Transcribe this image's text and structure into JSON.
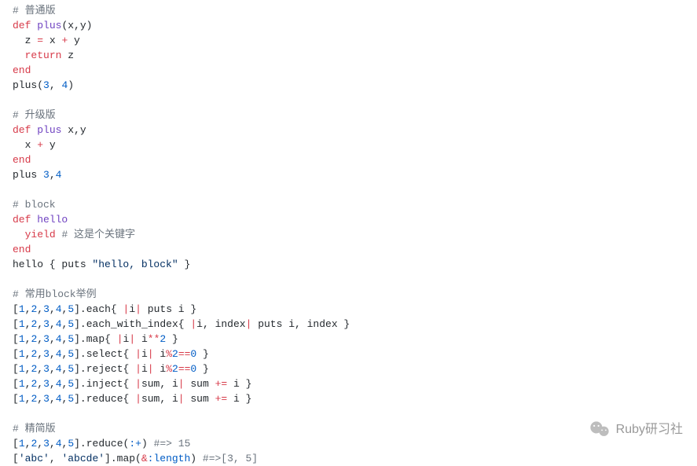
{
  "code": {
    "lines": [
      [
        [
          "comment",
          "# 普通版"
        ]
      ],
      [
        [
          "keyword",
          "def"
        ],
        [
          "plain",
          " "
        ],
        [
          "func",
          "plus"
        ],
        [
          "plain",
          "(x,y)"
        ]
      ],
      [
        [
          "plain",
          "  z "
        ],
        [
          "op",
          "="
        ],
        [
          "plain",
          " x "
        ],
        [
          "op",
          "+"
        ],
        [
          "plain",
          " y"
        ]
      ],
      [
        [
          "plain",
          "  "
        ],
        [
          "keyword",
          "return"
        ],
        [
          "plain",
          " z"
        ]
      ],
      [
        [
          "keyword",
          "end"
        ]
      ],
      [
        [
          "plain",
          "plus("
        ],
        [
          "num",
          "3"
        ],
        [
          "plain",
          ", "
        ],
        [
          "num",
          "4"
        ],
        [
          "plain",
          ")"
        ]
      ],
      [
        [
          "plain",
          ""
        ]
      ],
      [
        [
          "comment",
          "# 升级版"
        ]
      ],
      [
        [
          "keyword",
          "def"
        ],
        [
          "plain",
          " "
        ],
        [
          "func",
          "plus"
        ],
        [
          "plain",
          " x,y"
        ]
      ],
      [
        [
          "plain",
          "  x "
        ],
        [
          "op",
          "+"
        ],
        [
          "plain",
          " y"
        ]
      ],
      [
        [
          "keyword",
          "end"
        ]
      ],
      [
        [
          "plain",
          "plus "
        ],
        [
          "num",
          "3"
        ],
        [
          "plain",
          ","
        ],
        [
          "num",
          "4"
        ]
      ],
      [
        [
          "plain",
          ""
        ]
      ],
      [
        [
          "comment",
          "# block"
        ]
      ],
      [
        [
          "keyword",
          "def"
        ],
        [
          "plain",
          " "
        ],
        [
          "func",
          "hello"
        ]
      ],
      [
        [
          "plain",
          "  "
        ],
        [
          "keyword",
          "yield"
        ],
        [
          "plain",
          " "
        ],
        [
          "comment",
          "# 这是个关键字"
        ]
      ],
      [
        [
          "keyword",
          "end"
        ]
      ],
      [
        [
          "plain",
          "hello { puts "
        ],
        [
          "string",
          "\"hello, block\""
        ],
        [
          "plain",
          " }"
        ]
      ],
      [
        [
          "plain",
          ""
        ]
      ],
      [
        [
          "comment",
          "# 常用block举例"
        ]
      ],
      [
        [
          "plain",
          "["
        ],
        [
          "num",
          "1"
        ],
        [
          "plain",
          ","
        ],
        [
          "num",
          "2"
        ],
        [
          "plain",
          ","
        ],
        [
          "num",
          "3"
        ],
        [
          "plain",
          ","
        ],
        [
          "num",
          "4"
        ],
        [
          "plain",
          ","
        ],
        [
          "num",
          "5"
        ],
        [
          "plain",
          "].each{ "
        ],
        [
          "op",
          "|"
        ],
        [
          "plain",
          "i"
        ],
        [
          "op",
          "|"
        ],
        [
          "plain",
          " puts i }"
        ]
      ],
      [
        [
          "plain",
          "["
        ],
        [
          "num",
          "1"
        ],
        [
          "plain",
          ","
        ],
        [
          "num",
          "2"
        ],
        [
          "plain",
          ","
        ],
        [
          "num",
          "3"
        ],
        [
          "plain",
          ","
        ],
        [
          "num",
          "4"
        ],
        [
          "plain",
          ","
        ],
        [
          "num",
          "5"
        ],
        [
          "plain",
          "].each_with_index{ "
        ],
        [
          "op",
          "|"
        ],
        [
          "plain",
          "i, index"
        ],
        [
          "op",
          "|"
        ],
        [
          "plain",
          " puts i, index }"
        ]
      ],
      [
        [
          "plain",
          "["
        ],
        [
          "num",
          "1"
        ],
        [
          "plain",
          ","
        ],
        [
          "num",
          "2"
        ],
        [
          "plain",
          ","
        ],
        [
          "num",
          "3"
        ],
        [
          "plain",
          ","
        ],
        [
          "num",
          "4"
        ],
        [
          "plain",
          ","
        ],
        [
          "num",
          "5"
        ],
        [
          "plain",
          "].map{ "
        ],
        [
          "op",
          "|"
        ],
        [
          "plain",
          "i"
        ],
        [
          "op",
          "|"
        ],
        [
          "plain",
          " i"
        ],
        [
          "op",
          "**"
        ],
        [
          "num",
          "2"
        ],
        [
          "plain",
          " }"
        ]
      ],
      [
        [
          "plain",
          "["
        ],
        [
          "num",
          "1"
        ],
        [
          "plain",
          ","
        ],
        [
          "num",
          "2"
        ],
        [
          "plain",
          ","
        ],
        [
          "num",
          "3"
        ],
        [
          "plain",
          ","
        ],
        [
          "num",
          "4"
        ],
        [
          "plain",
          ","
        ],
        [
          "num",
          "5"
        ],
        [
          "plain",
          "].select{ "
        ],
        [
          "op",
          "|"
        ],
        [
          "plain",
          "i"
        ],
        [
          "op",
          "|"
        ],
        [
          "plain",
          " i"
        ],
        [
          "op",
          "%"
        ],
        [
          "num",
          "2"
        ],
        [
          "op",
          "=="
        ],
        [
          "num",
          "0"
        ],
        [
          "plain",
          " }"
        ]
      ],
      [
        [
          "plain",
          "["
        ],
        [
          "num",
          "1"
        ],
        [
          "plain",
          ","
        ],
        [
          "num",
          "2"
        ],
        [
          "plain",
          ","
        ],
        [
          "num",
          "3"
        ],
        [
          "plain",
          ","
        ],
        [
          "num",
          "4"
        ],
        [
          "plain",
          ","
        ],
        [
          "num",
          "5"
        ],
        [
          "plain",
          "].reject{ "
        ],
        [
          "op",
          "|"
        ],
        [
          "plain",
          "i"
        ],
        [
          "op",
          "|"
        ],
        [
          "plain",
          " i"
        ],
        [
          "op",
          "%"
        ],
        [
          "num",
          "2"
        ],
        [
          "op",
          "=="
        ],
        [
          "num",
          "0"
        ],
        [
          "plain",
          " }"
        ]
      ],
      [
        [
          "plain",
          "["
        ],
        [
          "num",
          "1"
        ],
        [
          "plain",
          ","
        ],
        [
          "num",
          "2"
        ],
        [
          "plain",
          ","
        ],
        [
          "num",
          "3"
        ],
        [
          "plain",
          ","
        ],
        [
          "num",
          "4"
        ],
        [
          "plain",
          ","
        ],
        [
          "num",
          "5"
        ],
        [
          "plain",
          "].inject{ "
        ],
        [
          "op",
          "|"
        ],
        [
          "plain",
          "sum, i"
        ],
        [
          "op",
          "|"
        ],
        [
          "plain",
          " sum "
        ],
        [
          "op",
          "+="
        ],
        [
          "plain",
          " i }"
        ]
      ],
      [
        [
          "plain",
          "["
        ],
        [
          "num",
          "1"
        ],
        [
          "plain",
          ","
        ],
        [
          "num",
          "2"
        ],
        [
          "plain",
          ","
        ],
        [
          "num",
          "3"
        ],
        [
          "plain",
          ","
        ],
        [
          "num",
          "4"
        ],
        [
          "plain",
          ","
        ],
        [
          "num",
          "5"
        ],
        [
          "plain",
          "].reduce{ "
        ],
        [
          "op",
          "|"
        ],
        [
          "plain",
          "sum, i"
        ],
        [
          "op",
          "|"
        ],
        [
          "plain",
          " sum "
        ],
        [
          "op",
          "+="
        ],
        [
          "plain",
          " i }"
        ]
      ],
      [
        [
          "plain",
          ""
        ]
      ],
      [
        [
          "comment",
          "# 精简版"
        ]
      ],
      [
        [
          "plain",
          "["
        ],
        [
          "num",
          "1"
        ],
        [
          "plain",
          ","
        ],
        [
          "num",
          "2"
        ],
        [
          "plain",
          ","
        ],
        [
          "num",
          "3"
        ],
        [
          "plain",
          ","
        ],
        [
          "num",
          "4"
        ],
        [
          "plain",
          ","
        ],
        [
          "num",
          "5"
        ],
        [
          "plain",
          "].reduce("
        ],
        [
          "sym",
          ":+"
        ],
        [
          "plain",
          ") "
        ],
        [
          "comment",
          "#=> 15"
        ]
      ],
      [
        [
          "plain",
          "["
        ],
        [
          "string",
          "'abc'"
        ],
        [
          "plain",
          ", "
        ],
        [
          "string",
          "'abcde'"
        ],
        [
          "plain",
          "].map("
        ],
        [
          "op",
          "&"
        ],
        [
          "sym",
          ":length"
        ],
        [
          "plain",
          ") "
        ],
        [
          "comment",
          "#=>[3, 5]"
        ]
      ]
    ]
  },
  "watermark": {
    "text": "Ruby研习社"
  }
}
